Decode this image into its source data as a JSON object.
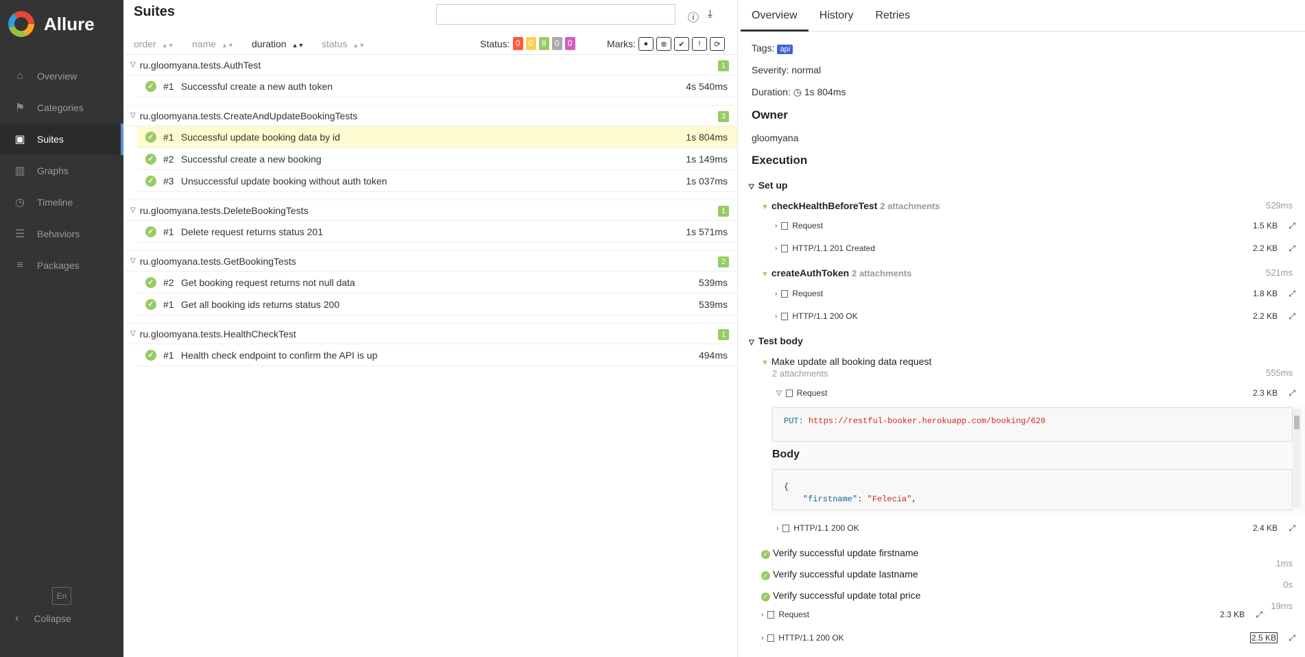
{
  "app": {
    "name": "Allure"
  },
  "sidebar": {
    "items": [
      {
        "label": "Overview",
        "icon": "home-icon"
      },
      {
        "label": "Categories",
        "icon": "flag-icon"
      },
      {
        "label": "Suites",
        "icon": "briefcase-icon",
        "active": true
      },
      {
        "label": "Graphs",
        "icon": "bar-chart-icon"
      },
      {
        "label": "Timeline",
        "icon": "clock-icon"
      },
      {
        "label": "Behaviors",
        "icon": "list-icon"
      },
      {
        "label": "Packages",
        "icon": "stack-icon"
      }
    ],
    "lang": "En",
    "collapse": "Collapse"
  },
  "suites": {
    "title": "Suites",
    "search_placeholder": "",
    "sort": {
      "order": "order",
      "name": "name",
      "duration": "duration",
      "status": "status"
    },
    "status_label": "Status:",
    "status_counts": [
      {
        "value": "0",
        "color": "#fd5a3e"
      },
      {
        "value": "0",
        "color": "#ffd050"
      },
      {
        "value": "8",
        "color": "#97cc64"
      },
      {
        "value": "0",
        "color": "#aaaaaa"
      },
      {
        "value": "0",
        "color": "#d35ebe"
      }
    ],
    "marks_label": "Marks:",
    "groups": [
      {
        "name": "ru.gloomyana.tests.AuthTest",
        "count": "1",
        "tests": [
          {
            "num": "#1",
            "name": "Successful create a new auth token",
            "duration": "4s 540ms"
          }
        ]
      },
      {
        "name": "ru.gloomyana.tests.CreateAndUpdateBookingTests",
        "count": "3",
        "tests": [
          {
            "num": "#1",
            "name": "Successful update booking data by id",
            "duration": "1s 804ms",
            "selected": true
          },
          {
            "num": "#2",
            "name": "Successful create a new booking",
            "duration": "1s 149ms"
          },
          {
            "num": "#3",
            "name": "Unsuccessful update booking without auth token",
            "duration": "1s 037ms"
          }
        ]
      },
      {
        "name": "ru.gloomyana.tests.DeleteBookingTests",
        "count": "1",
        "tests": [
          {
            "num": "#1",
            "name": "Delete request returns status 201",
            "duration": "1s 571ms"
          }
        ]
      },
      {
        "name": "ru.gloomyana.tests.GetBookingTests",
        "count": "2",
        "tests": [
          {
            "num": "#2",
            "name": "Get booking request returns not null data",
            "duration": "539ms"
          },
          {
            "num": "#1",
            "name": "Get all booking ids returns status 200",
            "duration": "539ms"
          }
        ]
      },
      {
        "name": "ru.gloomyana.tests.HealthCheckTest",
        "count": "1",
        "tests": [
          {
            "num": "#1",
            "name": "Health check endpoint to confirm the API is up",
            "duration": "494ms"
          }
        ]
      }
    ]
  },
  "detail": {
    "tabs": [
      "Overview",
      "History",
      "Retries"
    ],
    "tags_label": "Tags:",
    "tag": "api",
    "severity": "Severity: normal",
    "duration_label": "Duration:",
    "duration": "1s 804ms",
    "owner_heading": "Owner",
    "owner": "gloomyana",
    "execution_heading": "Execution",
    "setup": "Set up",
    "setup_steps": [
      {
        "name": "checkHealthBeforeTest",
        "sub": "2 attachments",
        "duration": "529ms",
        "attachments": [
          {
            "name": "Request",
            "size": "1.5 KB"
          },
          {
            "name": "HTTP/1.1 201 Created",
            "size": "2.2 KB"
          }
        ]
      },
      {
        "name": "createAuthToken",
        "sub": "2 attachments",
        "duration": "521ms",
        "attachments": [
          {
            "name": "Request",
            "size": "1.8 KB"
          },
          {
            "name": "HTTP/1.1 200 OK",
            "size": "2.2 KB"
          }
        ]
      }
    ],
    "body": "Test body",
    "body_step": {
      "name": "Make update all booking data request",
      "sub": "2 attachments",
      "duration": "555ms"
    },
    "open_attachment": {
      "name": "Request",
      "size": "2.3 KB",
      "method": "PUT:",
      "url": "https://restful-booker.herokuapp.com/booking/620",
      "body_heading": "Body",
      "brace": "{",
      "key": "\"firstname\"",
      "colon": ": ",
      "val": "\"Felecia\"",
      "comma": ","
    },
    "response_attachment": {
      "name": "HTTP/1.1 200 OK",
      "size": "2.4 KB"
    },
    "verify_steps": [
      {
        "name": "Verify successful update firstname",
        "duration": "1ms"
      },
      {
        "name": "Verify successful update lastname",
        "duration": "0s"
      },
      {
        "name": "Verify successful update total price",
        "duration": "19ms"
      }
    ],
    "bottom_attachments": [
      {
        "name": "Request",
        "size": "2.3 KB"
      },
      {
        "name": "HTTP/1.1 200 OK",
        "size": "2.5 KB"
      }
    ]
  }
}
